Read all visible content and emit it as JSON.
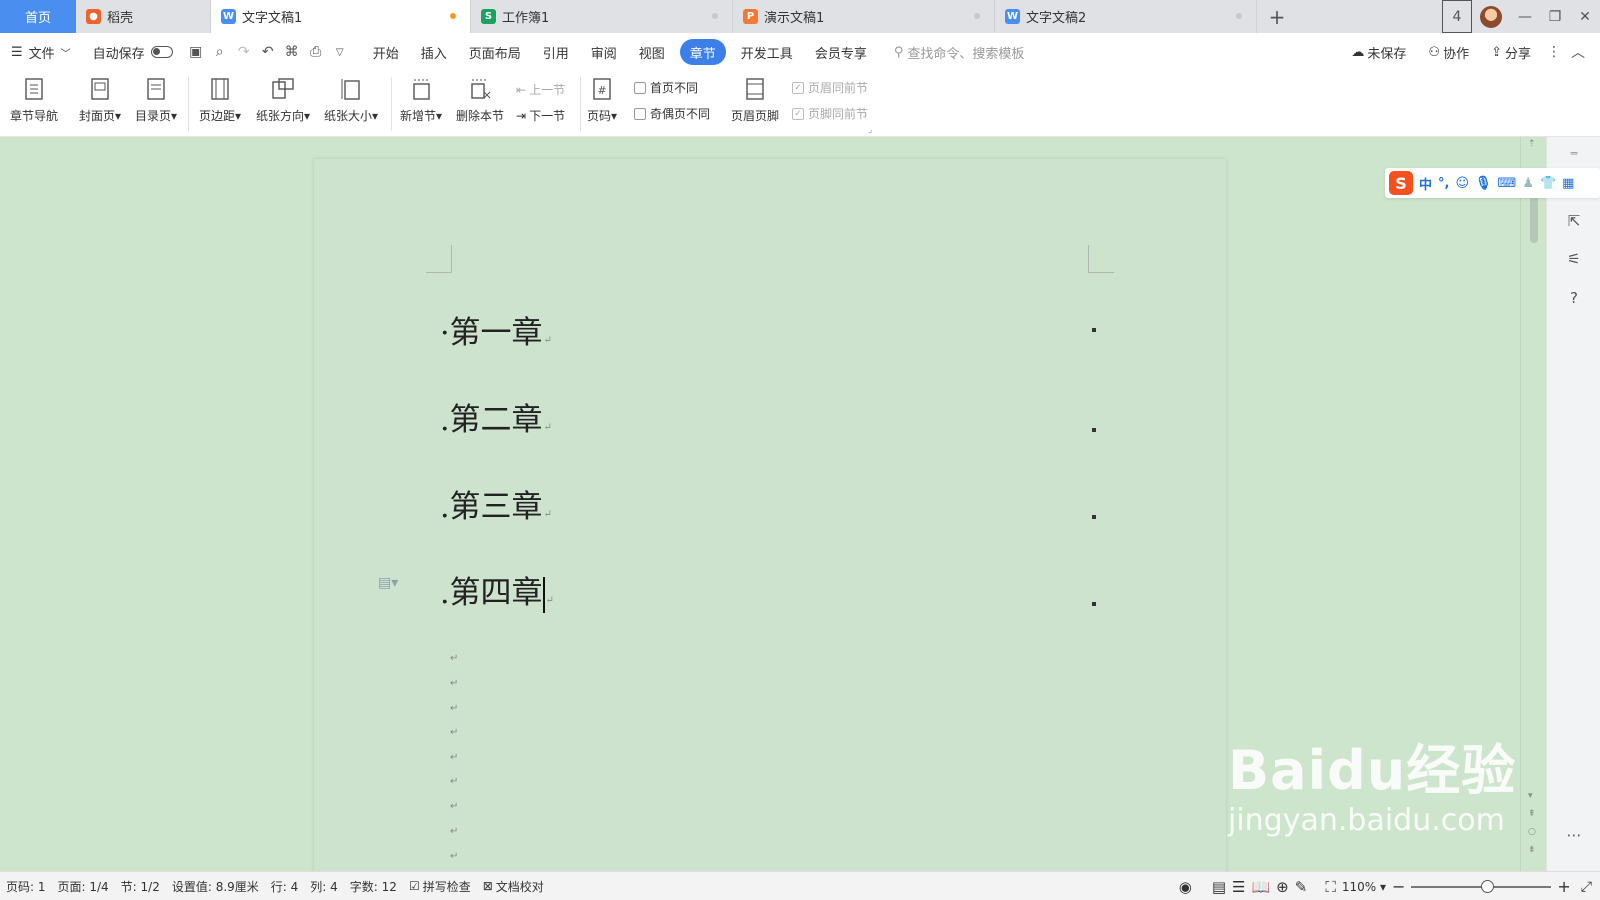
{
  "tabs": {
    "home": "首页",
    "items": [
      {
        "label": "稻壳",
        "color": "#f0622b",
        "glyph": "稻"
      },
      {
        "label": "文字文稿1",
        "color": "#4a8ff0",
        "glyph": "W"
      },
      {
        "label": "工作簿1",
        "color": "#1aa260",
        "glyph": "S"
      },
      {
        "label": "演示文稿1",
        "color": "#f07a33",
        "glyph": "P"
      },
      {
        "label": "文字文稿2",
        "color": "#4a8ff0",
        "glyph": "W"
      }
    ],
    "add": "+",
    "window_badge": "4"
  },
  "menubar": {
    "file": "文件",
    "autosave": "自动保存",
    "menus": [
      "开始",
      "插入",
      "页面布局",
      "引用",
      "审阅",
      "视图",
      "章节",
      "开发工具",
      "会员专享"
    ],
    "active_menu": "章节",
    "search_placeholder": "查找命令、搜索模板",
    "unsaved": "未保存",
    "collab": "协作",
    "share": "分享"
  },
  "ribbon": {
    "nav": "章节导航",
    "cover": "封面页",
    "toc": "目录页",
    "margin": "页边距",
    "orientation": "纸张方向",
    "size": "纸张大小",
    "new_section": "新增节",
    "delete_section": "删除本节",
    "prev_section": "上一节",
    "next_section": "下一节",
    "page_number": "页码",
    "first_page_diff": "首页不同",
    "odd_even_diff": "奇偶页不同",
    "header_footer": "页眉页脚",
    "header_same_prev": "页眉同前节",
    "footer_same_prev": "页脚同前节"
  },
  "document": {
    "headings": [
      "第一章",
      "第二章",
      "第三章",
      "第四章"
    ]
  },
  "statusbar": {
    "page_code": "页码: 1",
    "pages": "页面: 1/4",
    "section": "节: 1/2",
    "setting": "设置值: 8.9厘米",
    "row": "行: 4",
    "col": "列: 4",
    "words": "字数: 12",
    "spell": "拼写检查",
    "proof": "文档校对",
    "zoom": "110%"
  },
  "ime": {
    "logo": "S",
    "lang": "中"
  },
  "watermark": {
    "brand": "Baidu经验",
    "url": "jingyan.baidu.com"
  }
}
